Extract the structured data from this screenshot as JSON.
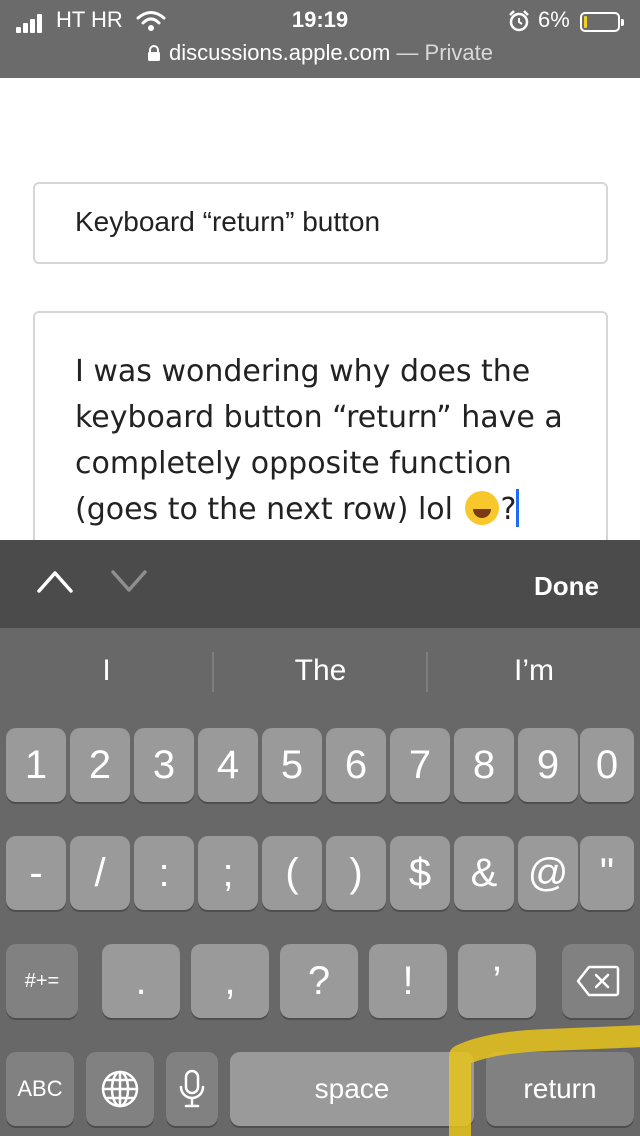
{
  "status_bar": {
    "carrier": "HT HR",
    "time": "19:19",
    "battery_percent": "6%",
    "battery_level": 0.06,
    "battery_color": "#f5d01c",
    "icons": [
      "signal-icon",
      "wifi-icon",
      "alarm-icon",
      "battery-icon"
    ]
  },
  "address_bar": {
    "domain": "discussions.apple.com",
    "separator": " — ",
    "mode": "Private"
  },
  "form": {
    "title_value": "Keyboard “return” button",
    "body_value": "I was wondering why does the keyboard button “return” have a completely opposite function (goes to the next row) lol",
    "body_suffix": "?",
    "emoji_name": "face-with-tears-of-joy-emoji"
  },
  "accessory_bar": {
    "done_label": "Done",
    "icons": [
      "chevron-up-icon",
      "chevron-down-icon"
    ]
  },
  "keyboard": {
    "suggestions": [
      "I",
      "The",
      "I’m"
    ],
    "row1": [
      "1",
      "2",
      "3",
      "4",
      "5",
      "6",
      "7",
      "8",
      "9",
      "0"
    ],
    "row2": [
      "-",
      "/",
      ":",
      ";",
      "(",
      ")",
      "$",
      "&",
      "@",
      "\""
    ],
    "row3_symbols_label": "#+=",
    "row3": [
      ".",
      ",",
      "?",
      "!",
      "’"
    ],
    "abc_label": "ABC",
    "space_label": "space",
    "return_label": "return",
    "icons": [
      "globe-icon",
      "microphone-icon",
      "backspace-icon"
    ],
    "highlight_color": "#e8c31a"
  }
}
